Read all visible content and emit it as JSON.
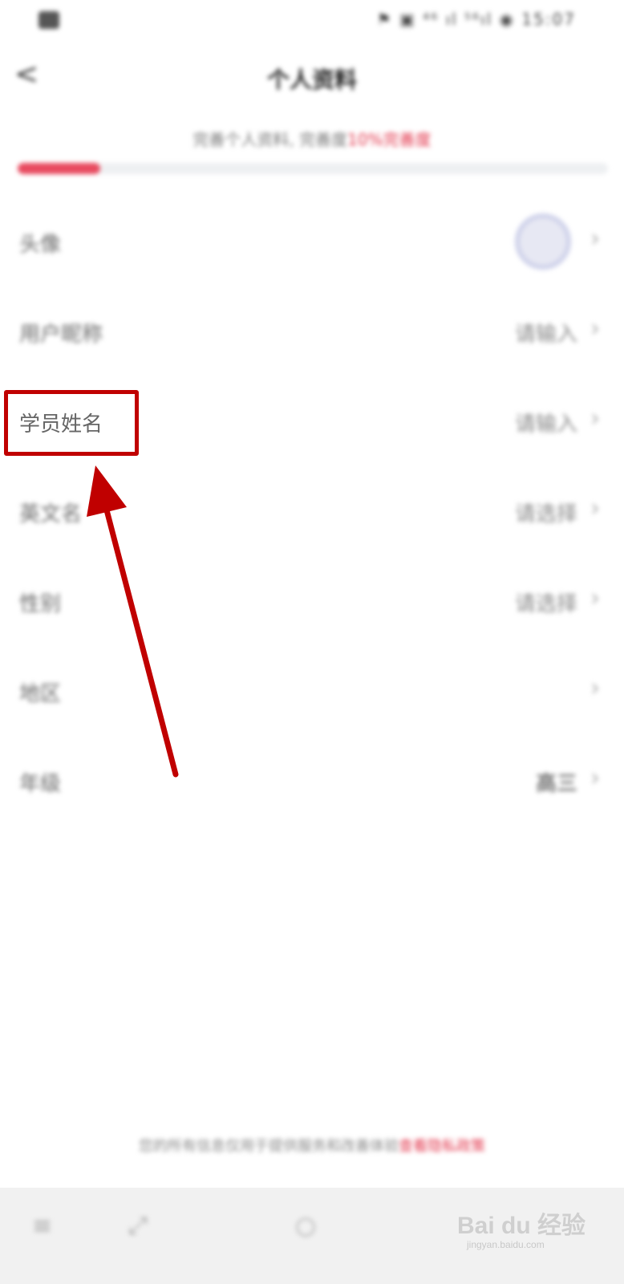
{
  "status_bar": {
    "left_icon": "notification-icon",
    "right_text": "⚑ ▣ ⁴⁶ ıl ⁵⁶ıl ◉ 15:07"
  },
  "nav": {
    "back_icon": "chevron-left-icon",
    "back_glyph": "<",
    "title": "个人资料"
  },
  "progress": {
    "hint_text": "完善个人资料, 完善度",
    "hint_link": "10%完善度",
    "fraction": 0.14,
    "fill_color": "#e84a5f"
  },
  "rows": [
    {
      "label": "头像",
      "value": "",
      "type": "avatar"
    },
    {
      "label": "用户昵称",
      "value": "请输入",
      "type": "text"
    },
    {
      "label": "学员姓名",
      "value": "请输入",
      "type": "text"
    },
    {
      "label": "英文名",
      "value": "请选择",
      "type": "text"
    },
    {
      "label": "性别",
      "value": "请选择",
      "type": "text"
    },
    {
      "label": "地区",
      "value": "",
      "type": "text"
    },
    {
      "label": "年级",
      "value": "高三",
      "type": "text"
    }
  ],
  "chevron_glyph": "›",
  "footer": {
    "note": "您的所有信息仅用于提供服务和改善体验",
    "link": "查看隐私政策"
  },
  "tab_bar": {
    "tabs": [
      "≡",
      "⤢",
      "○"
    ]
  },
  "watermark": {
    "main": "Bai du 经验",
    "sub": "jingyan.baidu.com"
  },
  "annotation": {
    "box_color": "#c00000",
    "arrow_color": "#c00000"
  }
}
